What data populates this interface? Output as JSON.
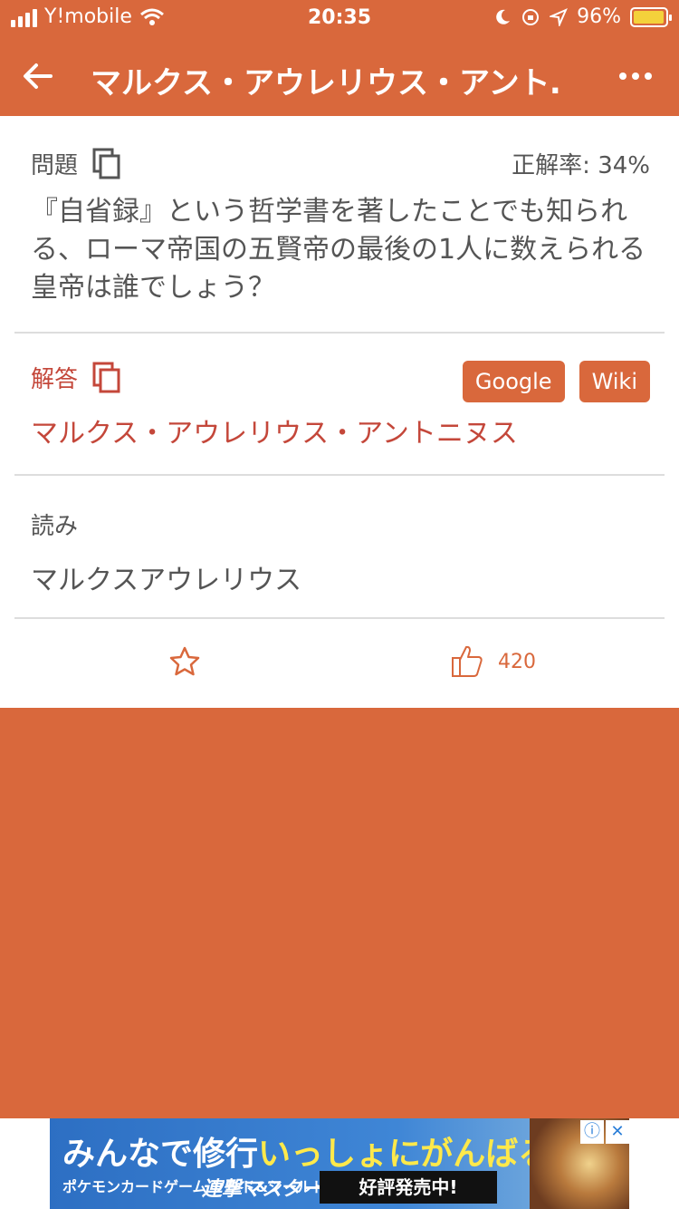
{
  "status": {
    "carrier": "Y!mobile",
    "time": "20:35",
    "battery": "96%"
  },
  "nav": {
    "title": "マルクス・アウレリウス・アント…"
  },
  "question": {
    "label": "問題",
    "rate": "正解率: 34%",
    "text": "『自省録』という哲学書を著したことでも知られる、ローマ帝国の五賢帝の最後の1人に数えられる皇帝は誰でしょう？"
  },
  "answer": {
    "label": "解答",
    "text": "マルクス・アウレリウス・アントニヌス",
    "google": "Google",
    "wiki": "Wiki"
  },
  "reading": {
    "label": "読み",
    "text": "マルクスアウレリウス"
  },
  "actions": {
    "likes": "420"
  },
  "ad": {
    "headline_a": "みんなで修行",
    "headline_b": "いっしょにがんばる!",
    "logo": "ポケモンカードゲーム ソード&シールド",
    "product": "連撃マスター",
    "cta": "好評発売中!"
  },
  "colors": {
    "accent": "#d9683c",
    "answer": "#c4473a"
  }
}
